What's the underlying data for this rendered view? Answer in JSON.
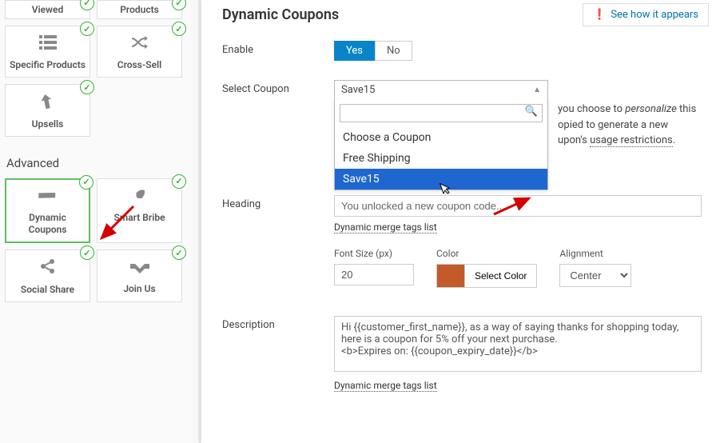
{
  "sidebar": {
    "row0": [
      {
        "label": "Viewed"
      },
      {
        "label": "Products"
      }
    ],
    "row1": [
      {
        "label": "Specific Products",
        "icon": "list"
      },
      {
        "label": "Cross-Sell",
        "icon": "shuffle"
      }
    ],
    "row2": [
      {
        "label": "Upsells",
        "icon": "arrow-up-turn"
      }
    ],
    "advanced_hdr": "Advanced",
    "row3": [
      {
        "label": "Dynamic Coupons",
        "icon": "ticket"
      },
      {
        "label": "Smart Bribe",
        "icon": "rocket"
      }
    ],
    "row4": [
      {
        "label": "Social Share",
        "icon": "share"
      },
      {
        "label": "Join Us",
        "icon": "handshake"
      }
    ]
  },
  "main": {
    "title": "Dynamic Coupons",
    "see_btn": "See how it appears",
    "enable": {
      "label": "Enable",
      "yes": "Yes",
      "no": "No"
    },
    "coupon": {
      "label": "Select Coupon",
      "selected": "Save15",
      "options": [
        "Choose a Coupon",
        "Free Shipping",
        "Save15"
      ],
      "search_placeholder": ""
    },
    "helper": {
      "part1_pre": "you choose to ",
      "part1_em": "personalize",
      "part1_post": " this",
      "part2": "opied to generate a new",
      "part3_pre": "upon's ",
      "part3_link": "usage restrictions",
      "part3_post": "."
    },
    "heading": {
      "label": "Heading",
      "value": "You unlocked a new coupon code...",
      "merge_link": "Dynamic merge tags list",
      "font_size_label": "Font Size (px)",
      "font_size_value": "20",
      "color_label": "Color",
      "color_value": "#c25a2a",
      "select_color_btn": "Select Color",
      "align_label": "Alignment",
      "align_value": "Center"
    },
    "description": {
      "label": "Description",
      "value": "Hi {{customer_first_name}}, as a way of saying thanks for shopping today, here is a coupon for 5% off your next purchase.\n<b>Expires on: {{coupon_expiry_date}}</b>",
      "merge_link": "Dynamic merge tags list"
    }
  }
}
